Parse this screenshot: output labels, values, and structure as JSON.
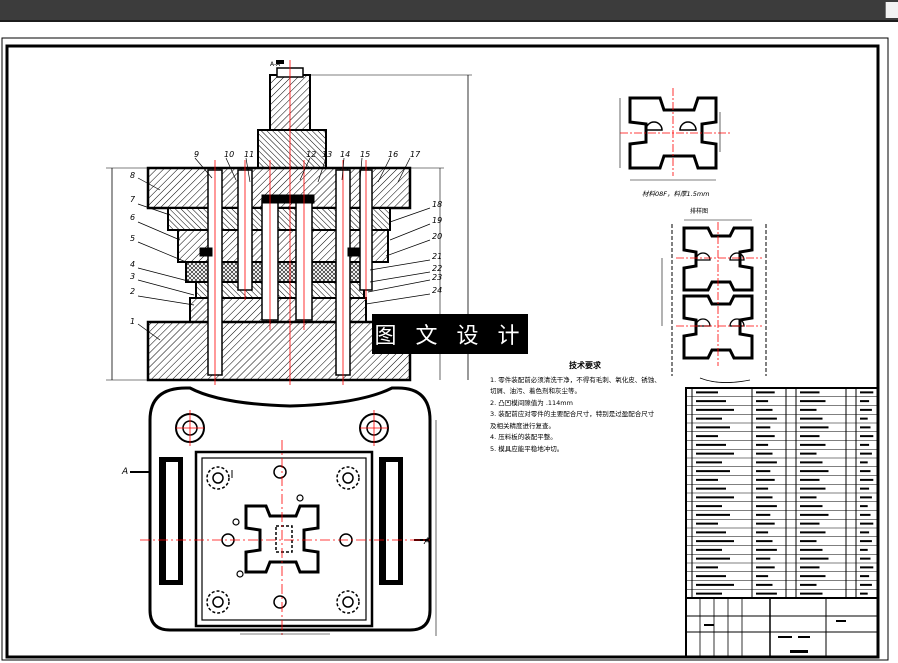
{
  "watermark": "图 文 设 计",
  "notes": {
    "title": "技术要求",
    "lines": [
      "1. 零件装配前必须清洗干净，不得有毛刺、氧化皮、锈蚀、",
      "   切屑、油污、着色剂和灰尘等。",
      "2. 凸凹模间隙值为 .114mm",
      "3. 装配前应对零件的主要配合尺寸，特别是过盈配合尺寸",
      "   及相关精度进行复查。",
      "4. 压料板的装配平整。",
      "5. 模具应能平稳地冲切。"
    ]
  },
  "section_label": "A-A",
  "balloons": [
    "9",
    "10",
    "11",
    "12",
    "13",
    "14",
    "15",
    "16",
    "17",
    "8",
    "7",
    "6",
    "5",
    "4",
    "3",
    "2",
    "1",
    "18",
    "19",
    "20",
    "21",
    "22",
    "23",
    "24"
  ],
  "part_note": "材料08F，料厚1.5mm",
  "strip_label": "排样图",
  "view_arrows": [
    "A",
    "A"
  ],
  "colors": {
    "accent_red": "#ff0000",
    "line": "#000000",
    "bg": "#ffffff"
  }
}
